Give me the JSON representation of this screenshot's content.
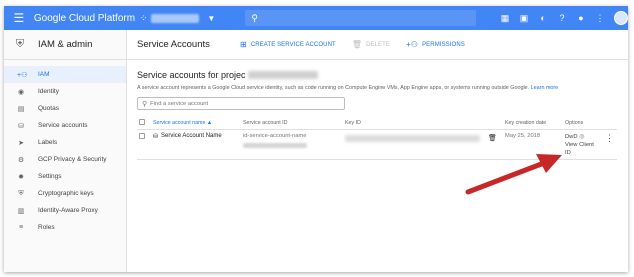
{
  "topbar": {
    "menu_icon": "hamburger-icon",
    "brand": "Google Cloud Platform",
    "project_icon": "project-dots-icon",
    "search_icon": "search-icon",
    "icons": [
      "gift-icon",
      "terminal-icon",
      "alert-icon",
      "help-icon",
      "bell-icon",
      "more-vert-icon"
    ]
  },
  "sidebar": {
    "title": "IAM & admin",
    "items": [
      {
        "label": "IAM",
        "icon": "person-add-icon",
        "active": true
      },
      {
        "label": "Identity",
        "icon": "account-circle-icon",
        "active": false
      },
      {
        "label": "Quotas",
        "icon": "quota-icon",
        "active": false
      },
      {
        "label": "Service accounts",
        "icon": "service-account-icon",
        "active": false
      },
      {
        "label": "Labels",
        "icon": "label-icon",
        "active": false
      },
      {
        "label": "GCP Privacy & Security",
        "icon": "settings-privacy-icon",
        "active": false
      },
      {
        "label": "Settings",
        "icon": "gear-icon",
        "active": false
      },
      {
        "label": "Cryptographic keys",
        "icon": "shield-icon",
        "active": false
      },
      {
        "label": "Identity-Aware Proxy",
        "icon": "proxy-icon",
        "active": false
      },
      {
        "label": "Roles",
        "icon": "roles-icon",
        "active": false
      }
    ]
  },
  "actionbar": {
    "title": "Service Accounts",
    "create": "CREATE SERVICE ACCOUNT",
    "delete": "DELETE",
    "permissions": "PERMISSIONS"
  },
  "content": {
    "heading": "Service accounts for projec",
    "description": "A service account represents a Google Cloud service identity, such as code running on Compute Engine VMs, App Engine apps, or systems running outside Google.",
    "learn_more": "Learn more",
    "filter_placeholder": "Find a service account"
  },
  "table": {
    "headers": {
      "name": "Service account name",
      "sort_indicator": "▲",
      "id": "Service account ID",
      "key_id": "Key ID",
      "created": "Key creation date",
      "options": "Options"
    },
    "rows": [
      {
        "name": "Service Account Name",
        "id_prefix": "id-service-account-name",
        "created": "May 25, 2018",
        "options_line1": "DwD",
        "options_line2": "View Client",
        "options_line3": "ID"
      }
    ]
  },
  "colors": {
    "brand_blue": "#4285f4",
    "accent": "#1a73e8",
    "arrow_red": "#c62828"
  }
}
